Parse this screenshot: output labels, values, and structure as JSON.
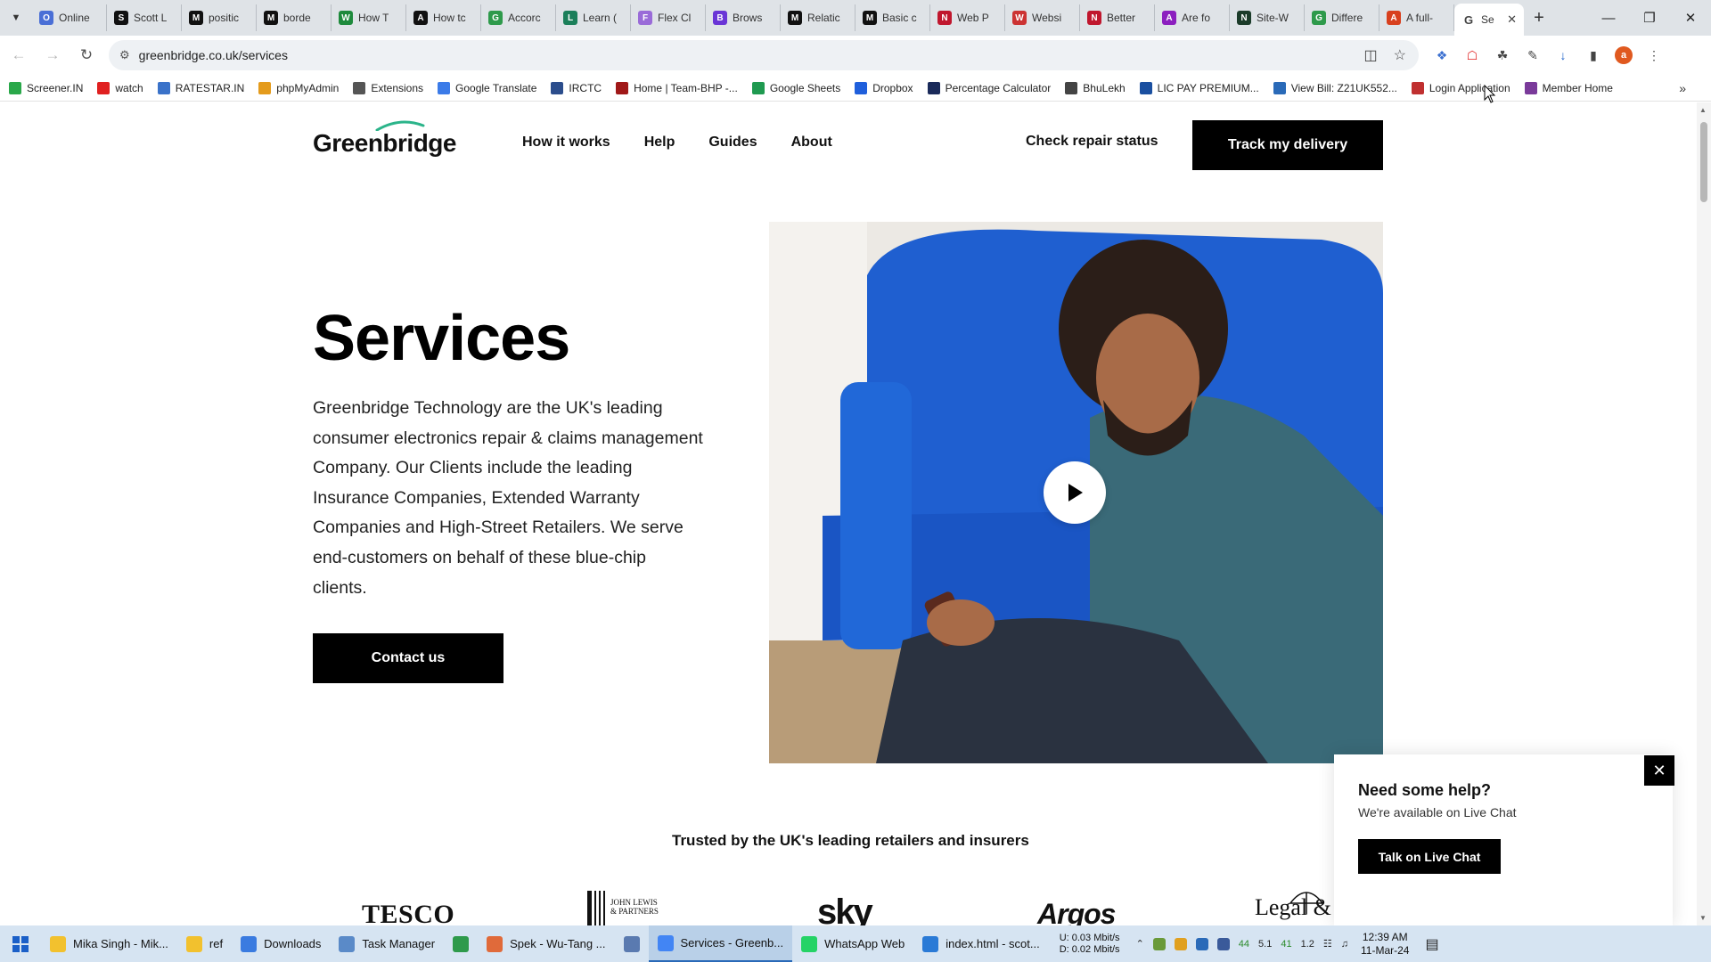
{
  "browser": {
    "tabs": [
      {
        "label": "Online",
        "icon": "O",
        "color": "#4a6fd6"
      },
      {
        "label": "Scott L",
        "icon": "S",
        "color": "#111111"
      },
      {
        "label": "positic",
        "icon": "M",
        "color": "#111111"
      },
      {
        "label": "borde",
        "icon": "M",
        "color": "#111111"
      },
      {
        "label": "How T",
        "icon": "W",
        "color": "#1e8a3c"
      },
      {
        "label": "How tc",
        "icon": "A",
        "color": "#111111"
      },
      {
        "label": "Accorc",
        "icon": "G",
        "color": "#2e9a4b"
      },
      {
        "label": "Learn (",
        "icon": "L",
        "color": "#1b7f5a"
      },
      {
        "label": "Flex Cl",
        "icon": "F",
        "color": "#9a6bd8"
      },
      {
        "label": "Brows",
        "icon": "B",
        "color": "#6a35d6"
      },
      {
        "label": "Relatic",
        "icon": "M",
        "color": "#111111"
      },
      {
        "label": "Basic c",
        "icon": "M",
        "color": "#111111"
      },
      {
        "label": "Web P",
        "icon": "N",
        "color": "#c0172e"
      },
      {
        "label": "Websi",
        "icon": "W",
        "color": "#cc3333"
      },
      {
        "label": "Better",
        "icon": "N",
        "color": "#c0172e"
      },
      {
        "label": "Are fo",
        "icon": "A",
        "color": "#8c1fbf"
      },
      {
        "label": "Site-W",
        "icon": "N",
        "color": "#1c3c2a"
      },
      {
        "label": "Differe",
        "icon": "G",
        "color": "#2e9a4b"
      },
      {
        "label": "A full-",
        "icon": "A",
        "color": "#d8401e"
      }
    ],
    "active_tab": {
      "label": "Se",
      "icon": "G",
      "color": "#444444"
    },
    "url": "greenbridge.co.uk/services",
    "bookmarks": [
      {
        "label": "Screener.IN",
        "color": "#2aa84a"
      },
      {
        "label": "watch",
        "color": "#e02020"
      },
      {
        "label": "RATESTAR.IN",
        "color": "#3a72c9"
      },
      {
        "label": "phpMyAdmin",
        "color": "#e49b1c"
      },
      {
        "label": "Extensions",
        "color": "#555555"
      },
      {
        "label": "Google Translate",
        "color": "#3b7be8"
      },
      {
        "label": "IRCTC",
        "color": "#2b4d8c"
      },
      {
        "label": "Home | Team-BHP -...",
        "color": "#a01818"
      },
      {
        "label": "Google Sheets",
        "color": "#1f9a50"
      },
      {
        "label": "Dropbox",
        "color": "#1f5fdc"
      },
      {
        "label": "Percentage Calculator",
        "color": "#1a2a5a"
      },
      {
        "label": "BhuLekh",
        "color": "#444444"
      },
      {
        "label": "LIC PAY PREMIUM...",
        "color": "#1a4fa0"
      },
      {
        "label": "View Bill: Z21UK552...",
        "color": "#2a6ab8"
      },
      {
        "label": "Login Application",
        "color": "#c03030"
      },
      {
        "label": "Member Home",
        "color": "#7a3a9a"
      }
    ]
  },
  "site": {
    "logo": "Greenbridge",
    "nav": [
      "How it works",
      "Help",
      "Guides",
      "About"
    ],
    "repair_link": "Check repair status",
    "track_button": "Track my delivery",
    "hero": {
      "title": "Services",
      "description": "Greenbridge Technology are the UK's leading consumer electronics repair & claims management Company. Our Clients include the leading Insurance Companies, Extended Warranty Companies and High-Street Retailers. We serve end-customers on behalf of these blue-chip clients.",
      "cta": "Contact us"
    },
    "trusted_heading": "Trusted by the UK's leading retailers and insurers",
    "partner_logos": {
      "tesco": "TESCO",
      "john_lewis": "JOHN LEWIS & PARTNERS",
      "sky": "sky",
      "argos": "Argos",
      "legal": "Legal &"
    },
    "help_widget": {
      "title": "Need some help?",
      "subtitle": "We're available on Live Chat",
      "button": "Talk on Live Chat"
    }
  },
  "taskbar": {
    "items": [
      {
        "label": "Mika Singh - Mik...",
        "color": "#f2c12e"
      },
      {
        "label": "ref",
        "color": "#f2c12e"
      },
      {
        "label": "Downloads",
        "color": "#3a7be0"
      },
      {
        "label": "Task Manager",
        "color": "#5a8ac8"
      },
      {
        "label": "",
        "color": "#2e9a4b"
      },
      {
        "label": "Spek - Wu-Tang ...",
        "color": "#e06a3a"
      },
      {
        "label": "",
        "color": "#5a7ab0"
      },
      {
        "label": "Services - Greenb...",
        "color": "#4285f4"
      },
      {
        "label": "WhatsApp Web",
        "color": "#25d366"
      },
      {
        "label": "index.html - scot...",
        "color": "#2a7ad6"
      }
    ],
    "net_up_label": "U:",
    "net_up": "0.03 Mbit/s",
    "net_down_label": "D:",
    "net_down": "0.02 Mbit/s",
    "tray_values": [
      "44",
      "5.1",
      "41",
      "1.2"
    ],
    "time": "12:39 AM",
    "date": "11-Mar-24"
  }
}
